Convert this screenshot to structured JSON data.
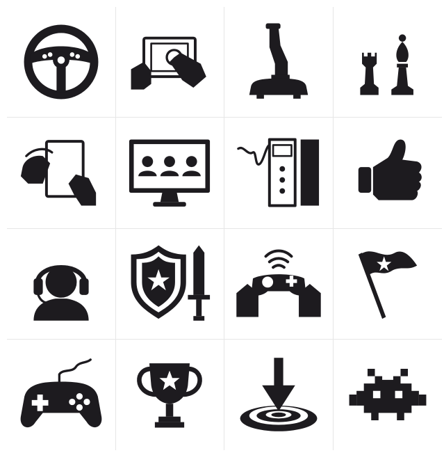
{
  "colors": {
    "ink": "#1d1b1f",
    "background": "#ffffff",
    "grid_line": "#e6e6e6"
  },
  "icons": [
    [
      "steering-wheel-icon",
      "tablet-touch-icon",
      "joystick-icon",
      "chess-pieces-icon"
    ],
    [
      "tablet-swipe-icon",
      "monitor-players-icon",
      "arcade-cabinet-icon",
      "thumbs-up-icon"
    ],
    [
      "headset-gamer-icon",
      "shield-sword-icon",
      "wireless-controller-icon",
      "star-flag-icon"
    ],
    [
      "gamepad-icon",
      "trophy-icon",
      "target-arrow-icon",
      "space-invader-icon"
    ]
  ]
}
